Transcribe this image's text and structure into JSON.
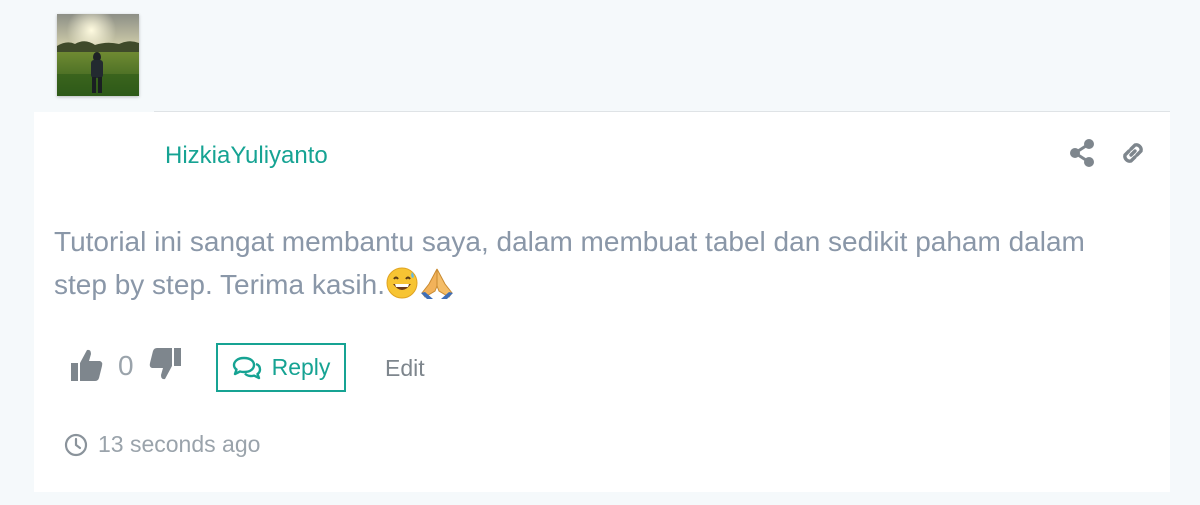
{
  "comment": {
    "author": "HizkiaYuliyanto",
    "text": "Tutorial ini sangat membantu saya, dalam membuat tabel dan sedikit paham dalam step by step. Terima kasih.",
    "emojis": [
      "grinning-sweat-emoji",
      "folded-hands-emoji"
    ],
    "vote_count": "0",
    "reply_label": "Reply",
    "edit_label": "Edit",
    "timestamp": "13 seconds ago"
  },
  "icons": {
    "share": "share-icon",
    "link": "link-icon",
    "thumbs_up": "thumbs-up-icon",
    "thumbs_down": "thumbs-down-icon",
    "reply": "comments-icon",
    "clock": "clock-icon"
  },
  "colors": {
    "accent": "#16a393",
    "text": "#8a97a8",
    "muted": "#9aa3ab",
    "icon": "#7e868d",
    "background": "#f5f9fb"
  }
}
